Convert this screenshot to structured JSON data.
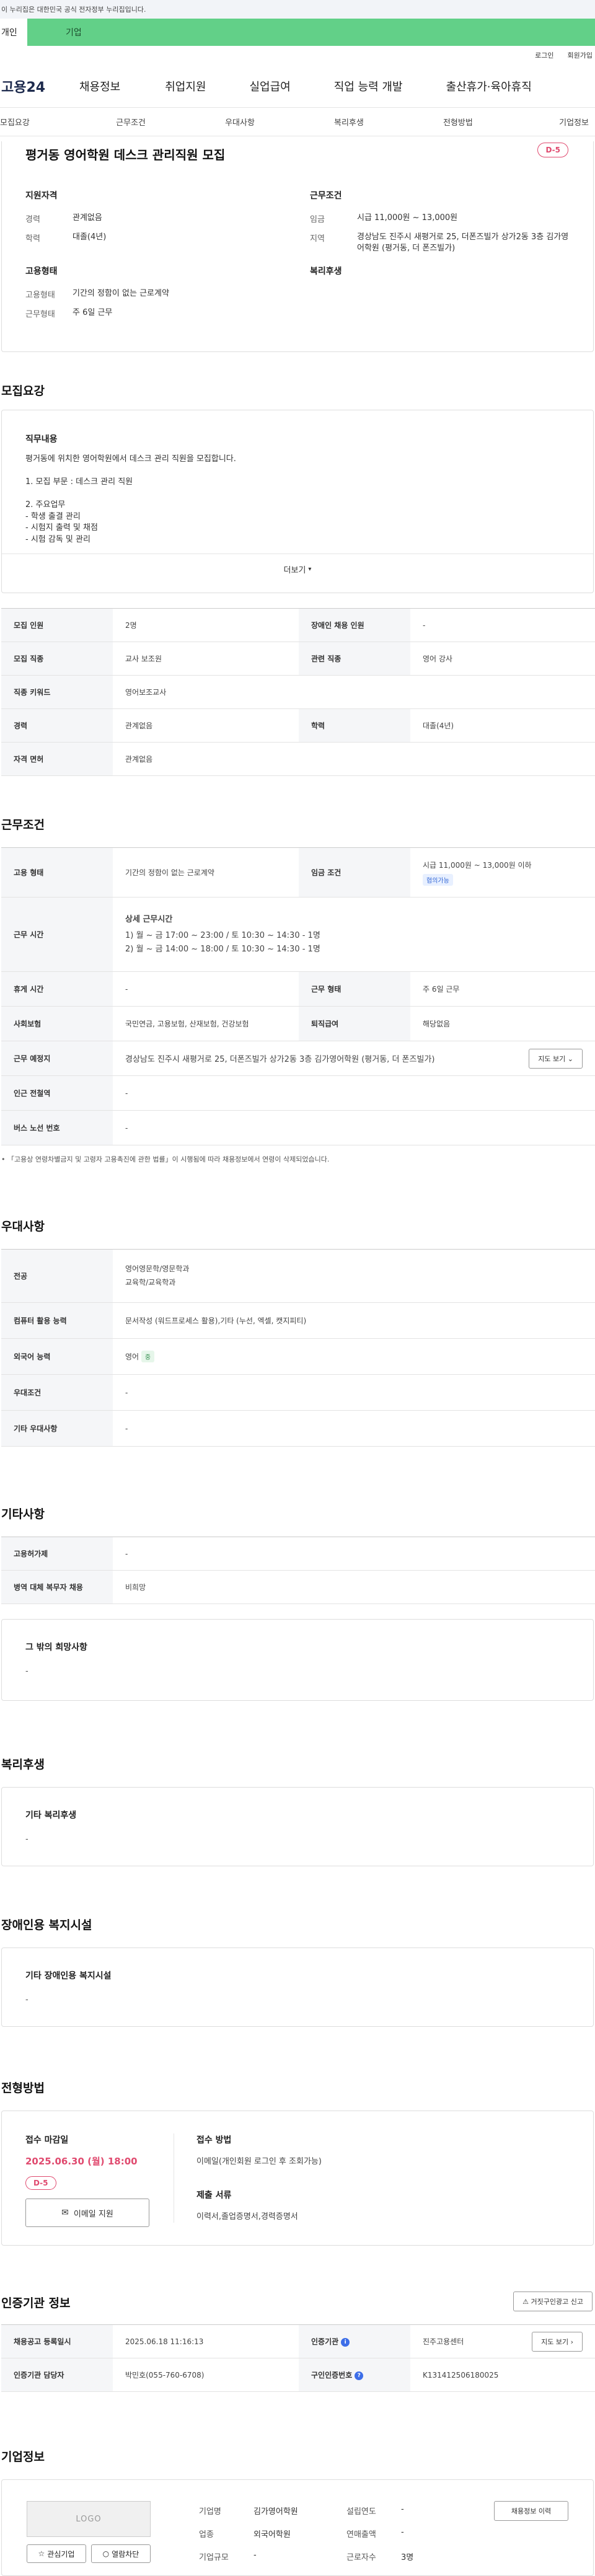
{
  "gov_banner": "이 누리집은 대한민국 공식 전자정부 누리집입니다.",
  "top_tabs": {
    "personal": "개인",
    "company": "기업"
  },
  "util_links": {
    "login": "로그인",
    "signup": "회원가입"
  },
  "logo": "고용24",
  "gnb": [
    "채용정보",
    "취업지원",
    "실업급여",
    "직업 능력 개발",
    "출산휴가·육아휴직"
  ],
  "subnav": [
    "모집요강",
    "근무조건",
    "우대사항",
    "복리후생",
    "전형방법",
    "기업정보"
  ],
  "summary": {
    "title": "평거동 영어학원 데스크 관리직원 모집",
    "dday": "D-5",
    "qualification": {
      "heading": "지원자격",
      "rows": [
        {
          "k": "경력",
          "v": "관계없음"
        },
        {
          "k": "학력",
          "v": "대졸(4년)"
        }
      ]
    },
    "conditions": {
      "heading": "근무조건",
      "rows": [
        {
          "k": "임금",
          "v": "시급 11,000원 ~ 13,000원"
        },
        {
          "k": "지역",
          "v": "경상남도 진주시 새평거로 25, 더폰즈빌가 상가2동 3층 김가영어학원 (평거동, 더 폰즈빌가)"
        }
      ]
    },
    "employment": {
      "heading": "고용형태",
      "rows": [
        {
          "k": "고용형태",
          "v": "기간의 정함이 없는 근로계약"
        },
        {
          "k": "근무형태",
          "v": "주 6일 근무"
        }
      ]
    },
    "welfare_heading": "복리후생"
  },
  "recruit": {
    "section_title": "모집요강",
    "duty_heading": "직무내용",
    "duty_lines": [
      "평거동에 위치한 영어학원에서 데스크 관리 직원을 모집합니다.",
      "",
      "1. 모집 부문 : 데스크 관리 직원",
      "",
      "2. 주요업무",
      "- 학생 출결 관리",
      "- 시험지 출력 및 채점",
      "- 시험 감독 및 관리"
    ],
    "more": "더보기",
    "table": [
      [
        {
          "k": "모집 인원",
          "v": "2명"
        },
        {
          "k": "장애인 채용 인원",
          "v": "-"
        }
      ],
      [
        {
          "k": "모집 직종",
          "v": "교사 보조원"
        },
        {
          "k": "관련 직종",
          "v": "영어 강사"
        }
      ],
      [
        {
          "k": "직종 키워드",
          "v": "영어보조교사"
        }
      ],
      [
        {
          "k": "경력",
          "v": "관계없음"
        },
        {
          "k": "학력",
          "v": "대졸(4년)"
        }
      ],
      [
        {
          "k": "자격 면허",
          "v": "관계없음"
        }
      ]
    ]
  },
  "work": {
    "section_title": "근무조건",
    "employment_type": {
      "k": "고용 형태",
      "v": "기간의 정함이 없는 근로계약"
    },
    "wage": {
      "k": "임금 조건",
      "v": "시급 11,000원 ~ 13,000원 이하",
      "tag": "협의가능"
    },
    "hours": {
      "k": "근무 시간",
      "title": "상세 근무시간",
      "lines": [
        "1) 월 ~ 금 17:00 ~ 23:00 / 토 10:30 ~ 14:30 - 1명",
        "2) 월 ~ 금 14:00 ~ 18:00 / 토 10:30 ~ 14:30 - 1명"
      ]
    },
    "rest": {
      "k": "휴게 시간",
      "v": "-"
    },
    "work_form": {
      "k": "근무 형태",
      "v": "주 6일 근무"
    },
    "insurance": {
      "k": "사회보험",
      "v": "국민연금, 고용보험, 산재보험, 건강보험"
    },
    "severance": {
      "k": "퇴직급여",
      "v": "해당없음"
    },
    "location": {
      "k": "근무 예정지",
      "v": "경상남도 진주시 새평거로 25, 더폰즈빌가 상가2동 3층 김가영어학원 (평거동, 더 폰즈빌가)",
      "map_btn": "지도 보기"
    },
    "subway": {
      "k": "인근 전철역",
      "v": "-"
    },
    "bus": {
      "k": "버스 노선 번호",
      "v": "-"
    },
    "note": "「고용상 연령차별금지 및 고령자 고용촉진에 관한 법률」이 시행됨에 따라 채용정보에서 연령이 삭제되었습니다."
  },
  "preference": {
    "section_title": "우대사항",
    "major": {
      "k": "전공",
      "lines": [
        "영어영문학/영문학과",
        "교육학/교육학과"
      ]
    },
    "computer": {
      "k": "컴퓨터 활용 능력",
      "v": "문서작성 (워드프로세스 활용),기타 (누선, 엑셀, 캣지피티)"
    },
    "language": {
      "k": "외국어 능력",
      "v": "영어",
      "badge": "중"
    },
    "conditions": {
      "k": "우대조건",
      "v": "-"
    },
    "other": {
      "k": "기타 우대사항",
      "v": "-"
    }
  },
  "other": {
    "section_title": "기타사항",
    "rows": [
      {
        "k": "고용허가제",
        "v": "-"
      },
      {
        "k": "병역 대체 복무자 채용",
        "v": "비희망"
      }
    ],
    "wish_heading": "그 밖의 희망사항",
    "wish_value": "-"
  },
  "welfare": {
    "section_title": "복리후생",
    "heading": "기타 복리후생",
    "value": "-"
  },
  "disability": {
    "section_title": "장애인용 복지시설",
    "heading": "기타 장애인용 복지시설",
    "value": "-"
  },
  "screening": {
    "section_title": "전형방법",
    "deadline_label": "접수 마감일",
    "deadline": "2025.06.30 (월) 18:00",
    "dday": "D-5",
    "email_btn": "이메일 지원",
    "method_label": "접수 방법",
    "method_value": "이메일(개인회원 로그인 후 조회가능)",
    "docs_label": "제출 서류",
    "docs_value": "이력서,졸업증명서,경력증명서"
  },
  "cert": {
    "section_title": "인증기관 정보",
    "report_btn": "거짓구인광고 신고",
    "rows": [
      [
        {
          "k": "채용공고 등록일시",
          "v": "2025.06.18 11:16:13"
        },
        {
          "k": "인증기관",
          "v": "진주고용센터",
          "icon": "i",
          "btn": "지도 보기"
        }
      ],
      [
        {
          "k": "인증기관 담당자",
          "v": "박민호(055-760-6708)"
        },
        {
          "k": "구인인증번호",
          "v": "K131412506180025",
          "icon": "?"
        }
      ]
    ]
  },
  "company": {
    "section_title": "기업정보",
    "logo_placeholder": "LOGO",
    "interest_btn": "관심기업",
    "block_btn": "열람차단",
    "history_btn": "채용정보 이력",
    "rows": [
      {
        "k": "기업명",
        "v": "김가영어학원"
      },
      {
        "k": "설립연도",
        "v": "-"
      },
      {
        "k": "업종",
        "v": "외국어학원"
      },
      {
        "k": "연매출액",
        "v": "-"
      },
      {
        "k": "기업규모",
        "v": "-"
      },
      {
        "k": "근로자수",
        "v": "3명"
      }
    ]
  }
}
